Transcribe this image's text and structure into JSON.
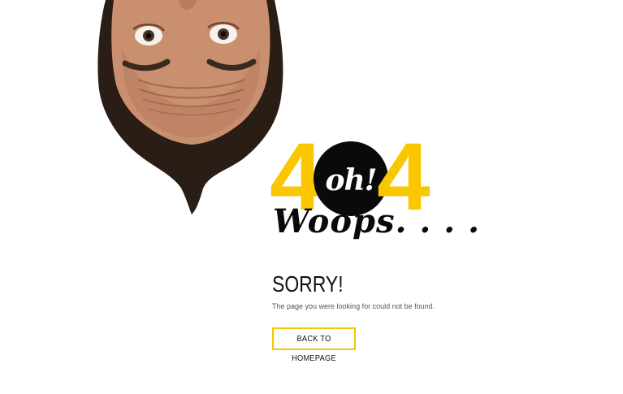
{
  "error": {
    "digit_left": "4",
    "badge_text": "oh!",
    "digit_right": "4",
    "exclamation": "Woops. . . .",
    "heading": "SORRY!",
    "message": "The page you were looking for could not be found."
  },
  "actions": {
    "home_label": "BACK TO HOMEPAGE"
  },
  "colors": {
    "accent": "#f9c600",
    "badge_bg": "#0a0a0a",
    "text": "#111111"
  },
  "icons": {
    "illustration": "upside-down-face-illustration"
  }
}
